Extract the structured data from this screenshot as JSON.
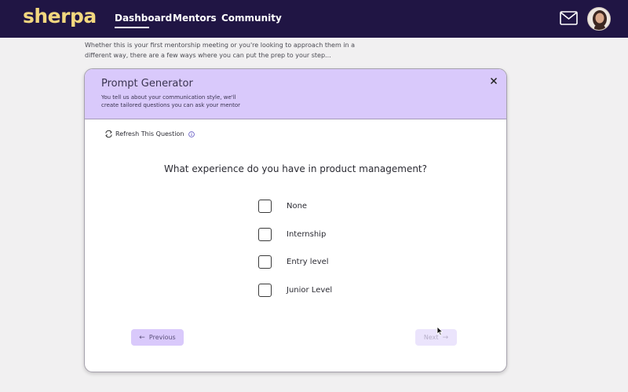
{
  "header": {
    "logo": "sherpa",
    "nav": [
      {
        "label": "Dashboard",
        "active": true
      },
      {
        "label": "Mentors",
        "active": false
      },
      {
        "label": "Community",
        "active": false
      }
    ],
    "icons": [
      "mail-icon",
      "avatar"
    ]
  },
  "intro_text": "Whether this is your first mentorship meeting or you're looking to approach them in a different way, there are a few ways where you can put the prep to your step...",
  "modal": {
    "title": "Prompt Generator",
    "subtitle": "You tell us about your communication style, we'll create tailored questions you can ask your mentor",
    "refresh_label": "Refresh This Question",
    "question": "What experience do you have in product management?",
    "options": [
      {
        "label": "None",
        "checked": false
      },
      {
        "label": "Internship",
        "checked": false
      },
      {
        "label": "Entry level",
        "checked": false
      },
      {
        "label": "Junior Level",
        "checked": false
      }
    ],
    "previous_label": "Previous",
    "next_label": "Next",
    "next_enabled": false
  },
  "colors": {
    "header_bg": "#201544",
    "logo": "#f2d77f",
    "modal_header": "#d9c9fb",
    "accent_purple": "#5a4f7a"
  }
}
